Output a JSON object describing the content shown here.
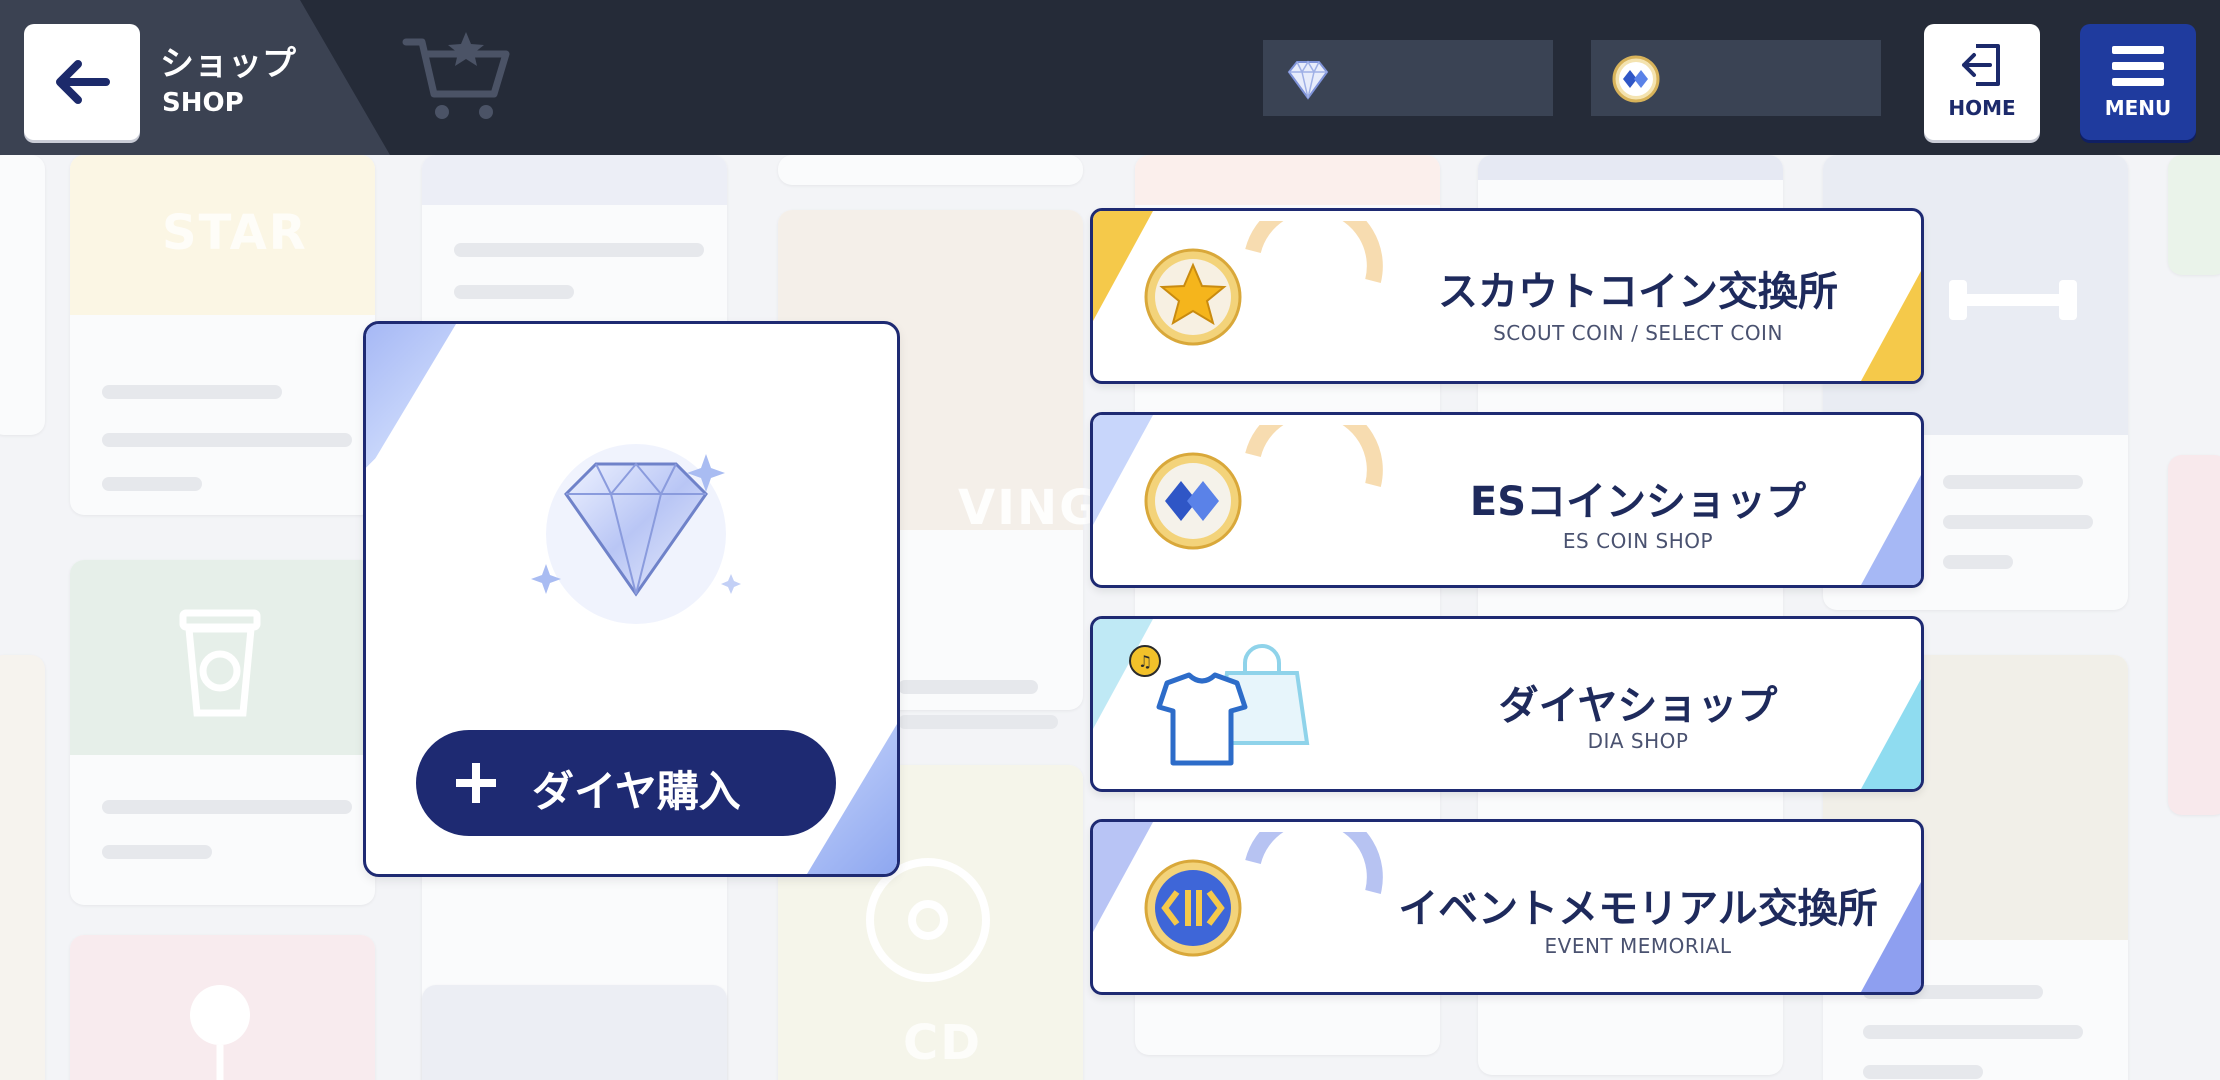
{
  "header": {
    "title_jp": "ショップ",
    "title_en": "SHOP",
    "back_icon": "arrow-left-icon",
    "cart_icon": "shopping-cart-star-icon",
    "home_label": "HOME",
    "menu_label": "MENU"
  },
  "currency": {
    "dia": {
      "icon": "diamond-icon",
      "value": ""
    },
    "es_coin": {
      "icon": "es-coin-icon",
      "value": ""
    }
  },
  "dia_card": {
    "icon": "diamond-icon",
    "buy_label": "ダイヤ購入"
  },
  "shops": [
    {
      "name_jp": "スカウトコイン交換所",
      "name_en": "SCOUT COIN / SELECT COIN",
      "icon": "star-coin-icon",
      "accent": "#f5c94a"
    },
    {
      "name_jp": "ESコインショップ",
      "name_en": "ES COIN SHOP",
      "icon": "es-coin-icon",
      "accent": "#a6b8f5"
    },
    {
      "name_jp": "ダイヤショップ",
      "name_en": "DIA SHOP",
      "icon": "tshirt-bag-icon",
      "accent": "#8fdcf0"
    },
    {
      "name_jp": "イベントメモリアル交換所",
      "name_en": "EVENT MEMORIAL",
      "icon": "event-memorial-coin-icon",
      "accent": "#8e9ff0"
    }
  ],
  "background": {
    "words": [
      "STAR",
      "VING",
      "CD"
    ]
  },
  "colors": {
    "navy": "#1e2a72",
    "header_bg": "#252b38",
    "menu_blue": "#1f3b9e"
  }
}
